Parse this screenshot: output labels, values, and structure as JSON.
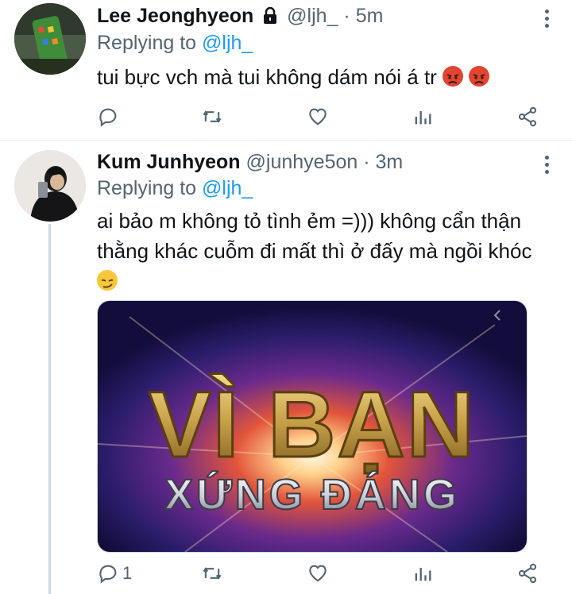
{
  "tweets": [
    {
      "name": "Lee Jeonghyeon",
      "handle": "@ljh_",
      "time": "5m",
      "replying_prefix": "Replying to",
      "replying_to": "@ljh_",
      "text": "tui bực vch mà tui không dám nói á tr",
      "emojis": [
        "angry-face",
        "angry-face"
      ],
      "protected": true,
      "reply_count": "",
      "icons": [
        "reply-icon",
        "retweet-icon",
        "like-icon",
        "analytics-icon",
        "share-icon"
      ]
    },
    {
      "name": "Kum Junhyeon",
      "handle": "@junhye5on",
      "time": "3m",
      "replying_prefix": "Replying to",
      "replying_to": "@ljh_",
      "text_line1": "ai bảo m không tỏ tình ẻm =))) không cẩn thận",
      "text_line2": "thằng khác cuỗm đi mất thì ở đấy mà ngồi khóc",
      "emojis": [
        "smirking-face"
      ],
      "media_text_top": "VÌ BẠN",
      "media_text_bottom": "XỨNG ĐÁNG",
      "reply_count": "1",
      "icons": [
        "reply-icon",
        "retweet-icon",
        "like-icon",
        "analytics-icon",
        "share-icon"
      ]
    }
  ],
  "separator": "·",
  "colors": {
    "text": "#0f1419",
    "secondary": "#536471",
    "link": "#1d9bf0",
    "divider": "#e6ecf0"
  }
}
